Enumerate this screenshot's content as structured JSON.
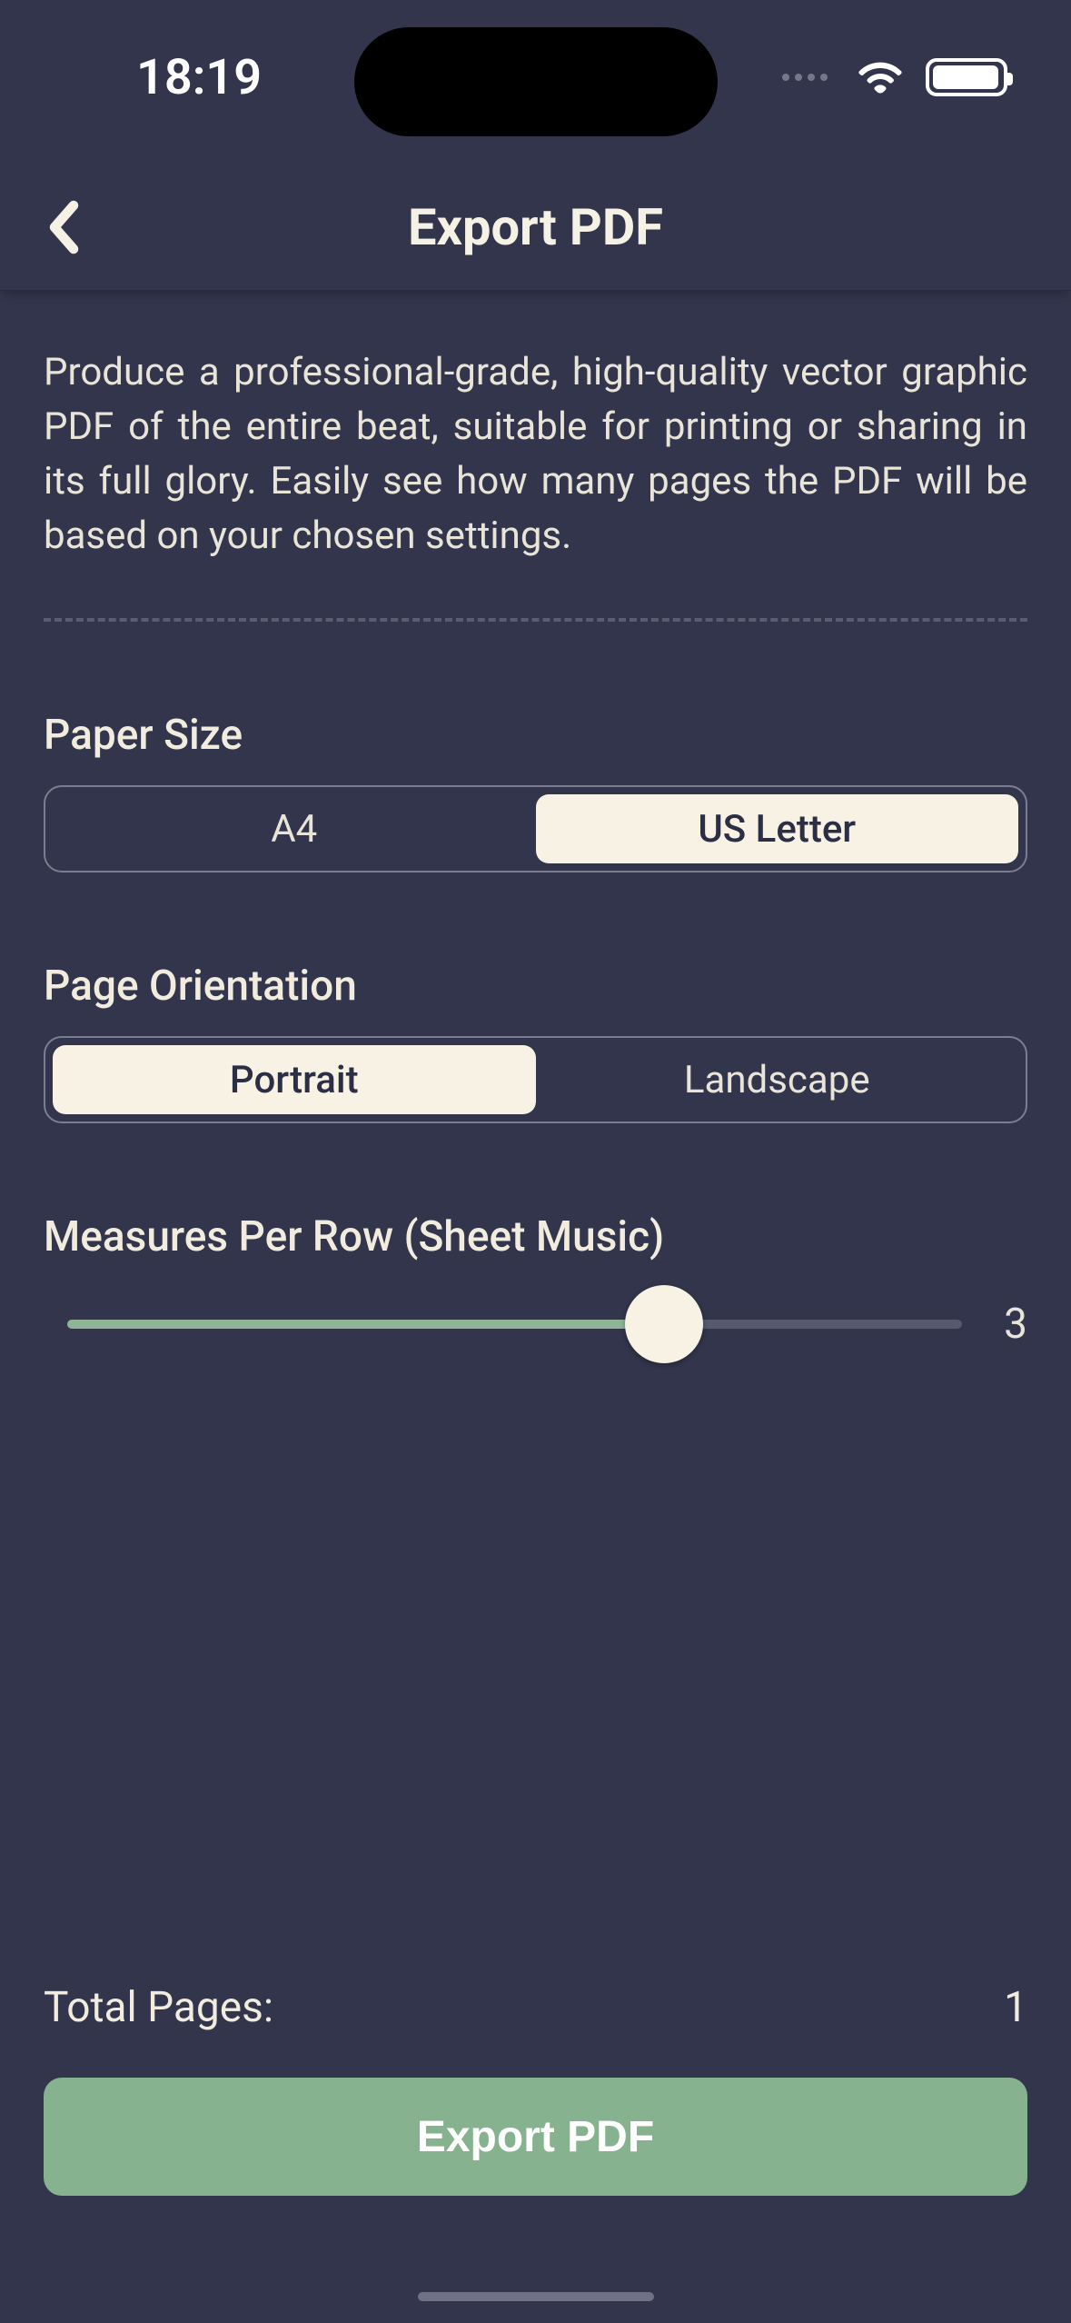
{
  "status": {
    "time": "18:19"
  },
  "header": {
    "title": "Export PDF"
  },
  "description": "Produce a professional-grade, high-quality vector graphic PDF of the entire beat, suitable for printing or sharing in its full glory. Easily see how many pages the PDF will be based on your chosen settings.",
  "paper_size": {
    "label": "Paper Size",
    "options": [
      "A4",
      "US Letter"
    ],
    "selected": "US Letter"
  },
  "orientation": {
    "label": "Page Orientation",
    "options": [
      "Portrait",
      "Landscape"
    ],
    "selected": "Portrait"
  },
  "measures": {
    "label": "Measures Per Row (Sheet Music)",
    "min": 1,
    "max": 4,
    "value": 3
  },
  "total_pages": {
    "label": "Total Pages:",
    "value": 1
  },
  "export_button": "Export PDF"
}
